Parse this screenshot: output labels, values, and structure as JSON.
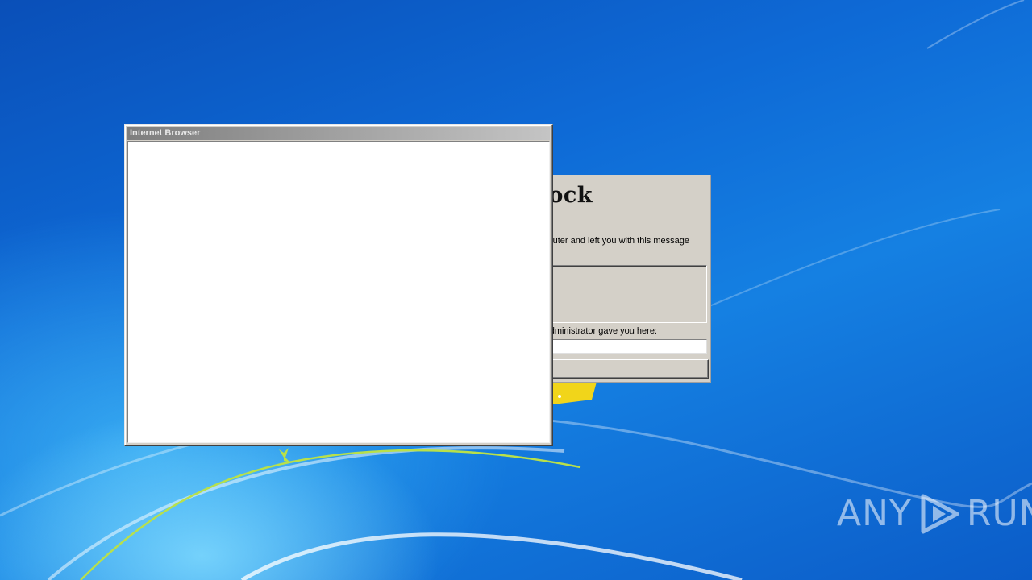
{
  "desktop": {
    "wallpaper_colors": {
      "sky": "#0e6ad6",
      "glow": "#82dcff",
      "accent": "#c8e84a"
    }
  },
  "lock_window": {
    "title_fragment": "ock",
    "message_fragment": "uter and left you with this message",
    "password_label_fragment": "dministrator gave you here:",
    "password_value": "",
    "unlock_button_label": ""
  },
  "browser_window": {
    "title": "Internet Browser",
    "titlebar_color": "#8e8e8e",
    "content_background": "#ffffff"
  },
  "watermark": {
    "left": "ANY",
    "right": "RUN",
    "icon": "play-logo-icon"
  }
}
